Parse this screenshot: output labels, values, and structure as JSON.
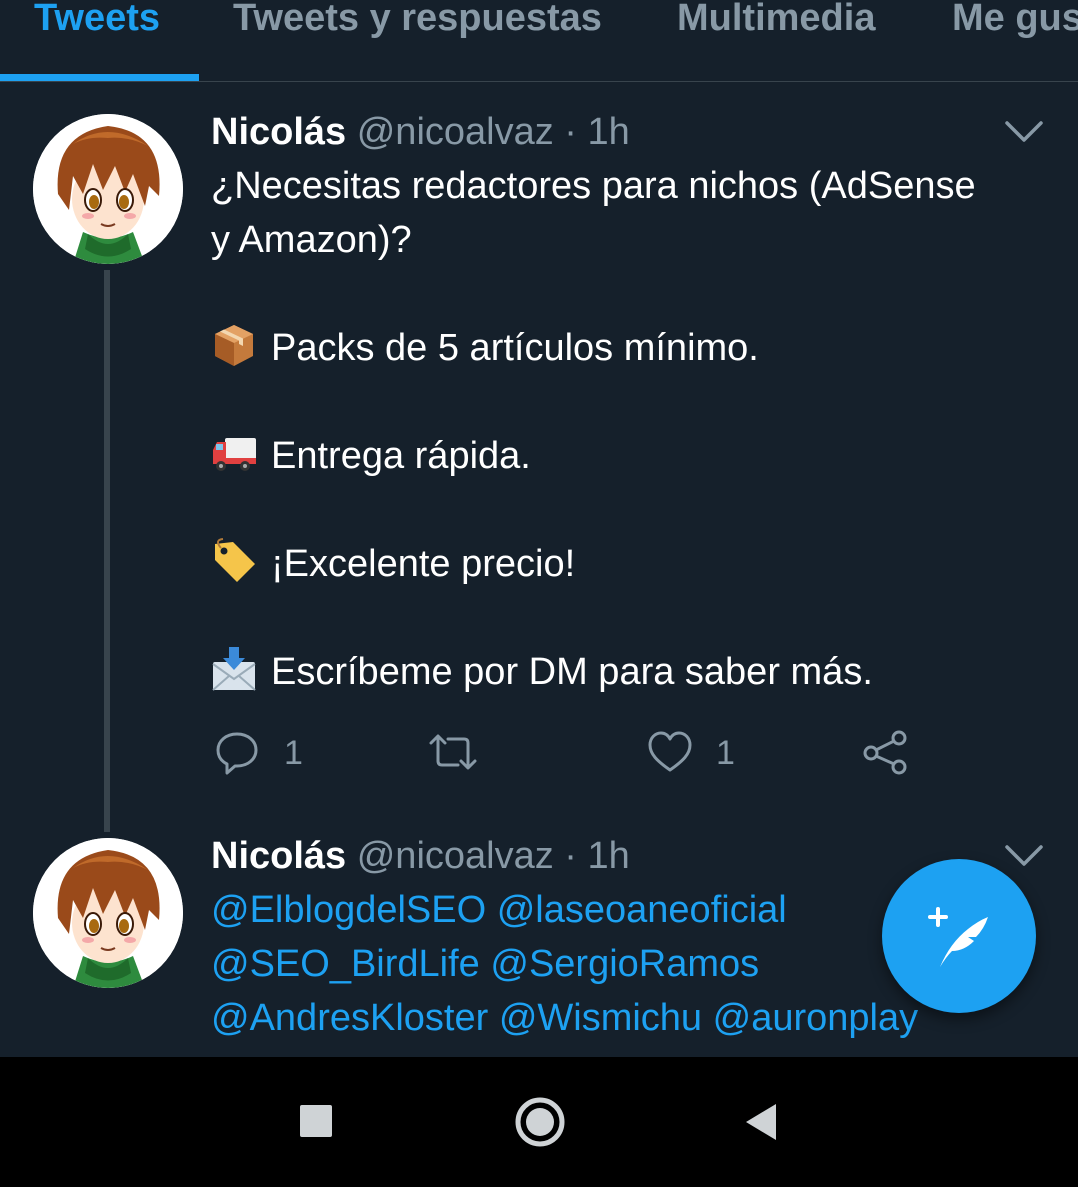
{
  "tabs": [
    {
      "label": "Tweets",
      "active": true
    },
    {
      "label": "Tweets y respuestas",
      "active": false
    },
    {
      "label": "Multimedia",
      "active": false
    },
    {
      "label": "Me gusta",
      "active": false
    }
  ],
  "tweets": [
    {
      "name": "Nicolás",
      "handle": "@nicoalvaz",
      "separator": "·",
      "time": "1h",
      "intro_lines": [
        "¿Necesitas redactores para nichos (AdSense",
        "y Amazon)?"
      ],
      "items": [
        {
          "icon": "package-emoji-icon",
          "text": "Packs de 5 artículos mínimo."
        },
        {
          "icon": "delivery-truck-emoji-icon",
          "text": "Entrega rápida."
        },
        {
          "icon": "price-tag-emoji-icon",
          "text": "¡Excelente precio!"
        },
        {
          "icon": "inbox-envelope-emoji-icon",
          "text": "Escríbeme por DM para saber más."
        }
      ],
      "actions": {
        "reply_count": "1",
        "like_count": "1"
      }
    },
    {
      "name": "Nicolás",
      "handle": "@nicoalvaz",
      "separator": "·",
      "time": "1h",
      "mention_lines": [
        [
          "@ElblogdelSEO",
          "@laseoaneoficial"
        ],
        [
          "@SEO_BirdLife",
          "@SergioRamos"
        ],
        [
          "@AndresKloster",
          "@Wismichu",
          "@auronplay"
        ]
      ]
    }
  ],
  "colors": {
    "background": "#15202b",
    "accent": "#1da1f2",
    "muted": "#8899a6",
    "divider": "#38444d"
  },
  "icons": {
    "fab": "compose-tweet-icon",
    "nav": [
      "recent-apps-icon",
      "home-icon",
      "back-icon"
    ]
  }
}
